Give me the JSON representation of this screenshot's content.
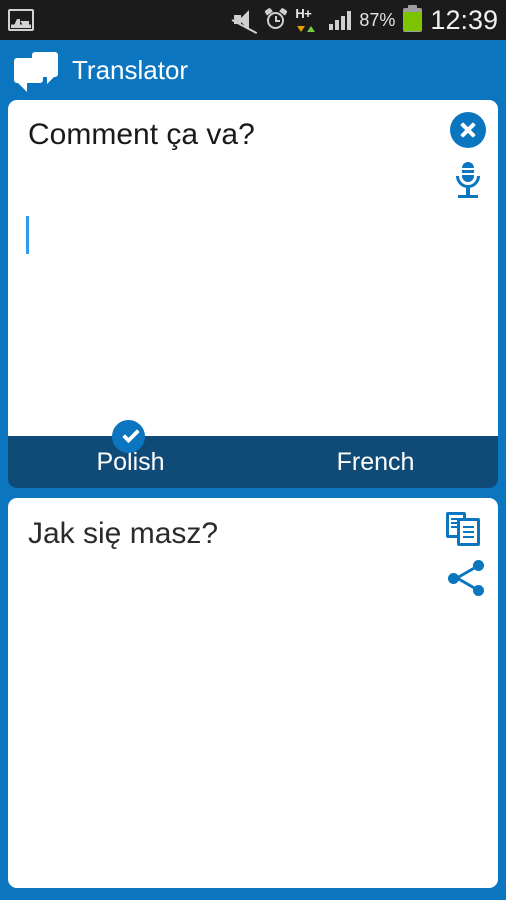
{
  "statusbar": {
    "notification_icon": "gallery-icon",
    "mute_icon": "mute-icon",
    "alarm_icon": "alarm-clock-icon",
    "network_label": "H+",
    "data_arrows": "down-up-arrows-icon",
    "signal_icon": "signal-bars-icon",
    "battery_percent": "87%",
    "battery_icon": "battery-icon",
    "time": "12:39"
  },
  "appbar": {
    "icon": "speech-bubbles-icon",
    "title": "Translator"
  },
  "source": {
    "text": "Comment ça va?",
    "clear_icon": "close-circle-icon",
    "mic_icon": "microphone-icon",
    "caret_color": "#2f9bf0"
  },
  "languages": {
    "source_lang": "Polish",
    "target_lang": "French",
    "selected_badge": "check-circle-icon",
    "bar_color": "#0f4b76"
  },
  "target": {
    "text": "Jak się masz?",
    "copy_icon": "copy-icon",
    "share_icon": "share-icon"
  },
  "theme": {
    "brand_blue": "#0b76bf",
    "dark_blue": "#0f4b76",
    "statusbar_bg": "#1b1b1b",
    "battery_green": "#7dc400"
  }
}
